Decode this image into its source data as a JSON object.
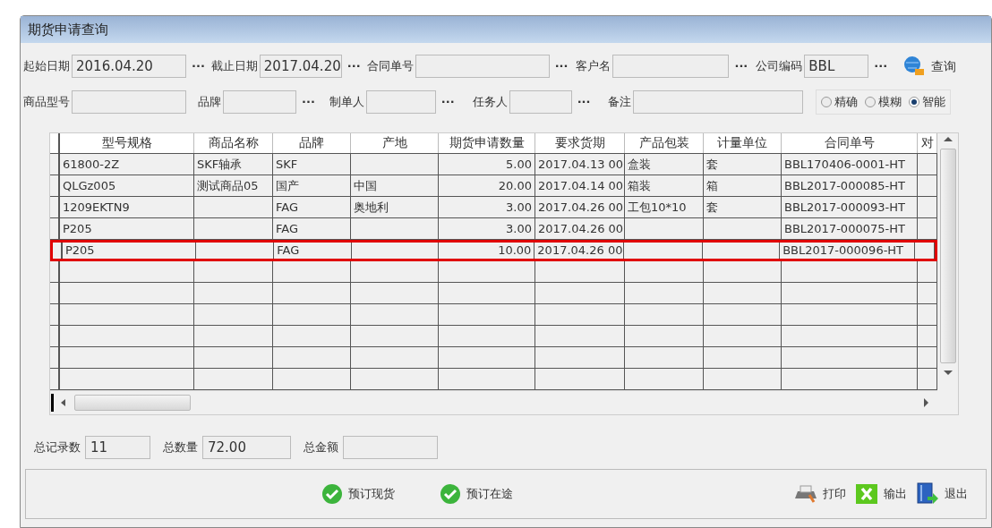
{
  "window": {
    "title": "期货申请查询"
  },
  "filters": [
    [
      {
        "label": "起始日期",
        "value": "2016.04.20",
        "picker": "···"
      },
      {
        "label": "截止日期",
        "value": "2017.04.20",
        "picker": "···"
      },
      {
        "label": "合同单号",
        "picker": "···"
      },
      {
        "label": "客户名",
        "picker": "···"
      },
      {
        "label": "公司编码",
        "value": "BBL",
        "picker": "···"
      }
    ],
    [
      {
        "label": "商品型号"
      },
      {
        "label": "品牌",
        "picker": "···"
      },
      {
        "label": "制单人",
        "picker": "···"
      },
      {
        "label": "任务人",
        "picker": "···"
      },
      {
        "label": "备注"
      }
    ]
  ],
  "query_button": "查询",
  "match_modes": [
    {
      "label": "精确",
      "selected": false
    },
    {
      "label": "模糊",
      "selected": false
    },
    {
      "label": "智能",
      "selected": true
    }
  ],
  "table": {
    "columns": [
      "型号规格",
      "商品名称",
      "品牌",
      "产地",
      "期货申请数量",
      "要求货期",
      "产品包装",
      "计量单位",
      "合同单号",
      "对"
    ],
    "rows": [
      {
        "highlighted": false,
        "cells": [
          "61800-2Z",
          "SKF轴承",
          "SKF",
          null,
          "5.00",
          "2017.04.13 00",
          "盒装",
          "套",
          "BBL170406-0001-HT",
          null
        ]
      },
      {
        "highlighted": false,
        "cells": [
          "QLGz005",
          "测试商品05",
          "国产",
          "中国",
          "20.00",
          "2017.04.14 00",
          "箱装",
          "箱",
          "BBL2017-000085-HT",
          null
        ]
      },
      {
        "highlighted": false,
        "cells": [
          "1209EKTN9",
          null,
          "FAG",
          "奥地利",
          "3.00",
          "2017.04.26 00",
          "工包10*10",
          "套",
          "BBL2017-000093-HT",
          null
        ]
      },
      {
        "highlighted": false,
        "cells": [
          "P205",
          null,
          "FAG",
          null,
          "3.00",
          "2017.04.26 00",
          null,
          null,
          "BBL2017-000075-HT",
          null
        ]
      },
      {
        "highlighted": true,
        "cells": [
          "P205",
          null,
          "FAG",
          null,
          "10.00",
          "2017.04.26 00",
          null,
          null,
          "BBL2017-000096-HT",
          null
        ]
      }
    ]
  },
  "totals": [
    {
      "label": "总记录数",
      "value": "11"
    },
    {
      "label": "总数量",
      "value": "72.00"
    },
    {
      "label": "总金额"
    }
  ],
  "actions": [
    {
      "kind": "check",
      "label": "预订现货"
    },
    {
      "kind": "check",
      "label": "预订在途"
    }
  ],
  "tools": [
    {
      "kind": "print",
      "label": "打印"
    },
    {
      "kind": "excel",
      "label": "输出"
    },
    {
      "kind": "exit",
      "label": "退出"
    }
  ]
}
